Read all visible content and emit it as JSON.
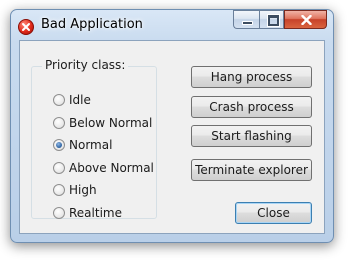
{
  "window": {
    "title": "Bad Application"
  },
  "priority": {
    "group_label": "Priority class:",
    "options": [
      "Idle",
      "Below Normal",
      "Normal",
      "Above Normal",
      "High",
      "Realtime"
    ],
    "selected": "Normal"
  },
  "buttons": {
    "hang": "Hang process",
    "crash": "Crash process",
    "flash": "Start flashing",
    "terminate": "Terminate explorer",
    "close": "Close"
  }
}
